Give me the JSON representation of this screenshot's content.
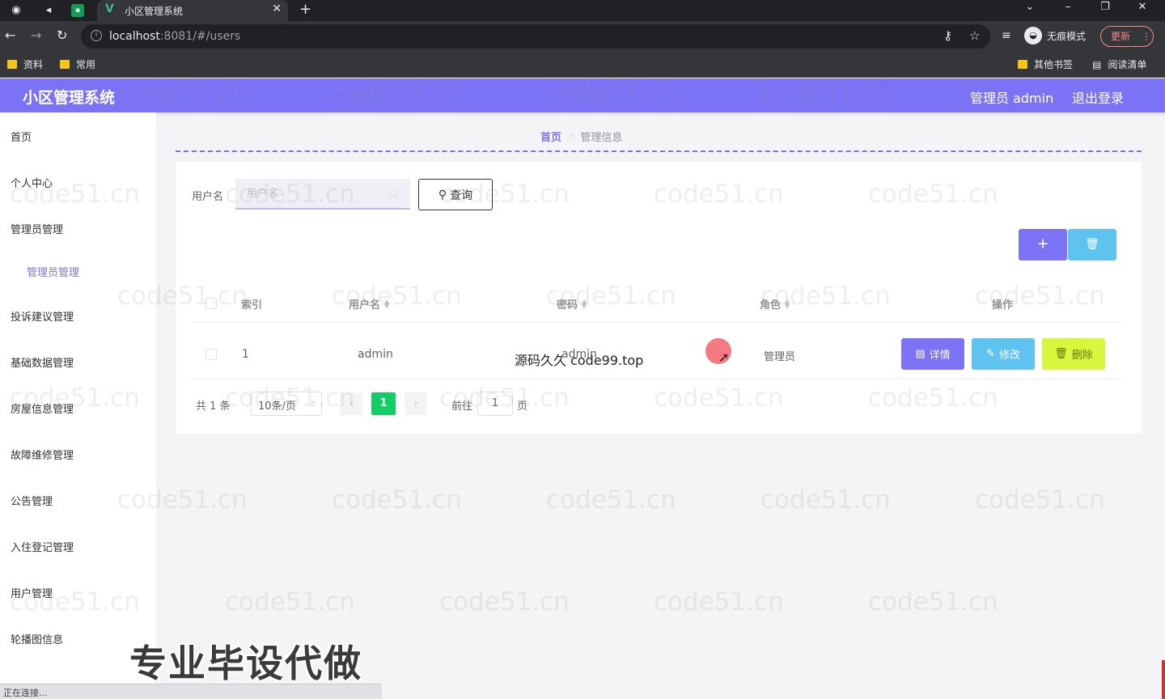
{
  "browser": {
    "tab_title": "小区管理系统",
    "url_host": "localhost",
    "url_rest": ":8081/#/users",
    "profile_label": "无痕模式",
    "update_label": "更新",
    "bookmarks": [
      "资料",
      "常用"
    ],
    "bookmarks_right": [
      "其他书签",
      "阅读清单"
    ],
    "status_text": "正在连接..."
  },
  "header": {
    "title": "小区管理系统",
    "admin_label": "管理员 admin",
    "logout_label": "退出登录"
  },
  "sidebar": {
    "items": [
      "首页",
      "个人中心",
      "管理员管理",
      "管理员管理",
      "投诉建议管理",
      "基础数据管理",
      "房屋信息管理",
      "故障维修管理",
      "公告管理",
      "入住登记管理",
      "用户管理",
      "轮播图信息"
    ]
  },
  "breadcrumb": {
    "home": "首页",
    "current": "管理信息"
  },
  "search": {
    "label": "用户名",
    "placeholder": "用户名",
    "query_label": "查询"
  },
  "toolbar": {
    "add_icon": "plus-icon",
    "delete_icon": "trash-icon"
  },
  "table": {
    "headers": [
      "索引",
      "用户名",
      "密码",
      "角色",
      "操作"
    ],
    "rows": [
      {
        "index": "1",
        "username": "admin",
        "password": "admin",
        "role": "管理员"
      }
    ],
    "actions": {
      "detail": "详情",
      "edit": "修改",
      "delete": "删除"
    }
  },
  "pagination": {
    "total": "共 1 条",
    "page_size": "10条/页",
    "current_page": "1",
    "goto_pre": "前往",
    "goto_value": "1",
    "goto_post": "页"
  },
  "overlay": {
    "source_text": "源码久久 code99.top",
    "banner": "专业毕设代做",
    "watermark": "code51.cn"
  },
  "colors": {
    "primary": "#7b72f5",
    "info": "#5ec3ef",
    "danger_lime": "#d9f53e",
    "success": "#13ce66"
  }
}
